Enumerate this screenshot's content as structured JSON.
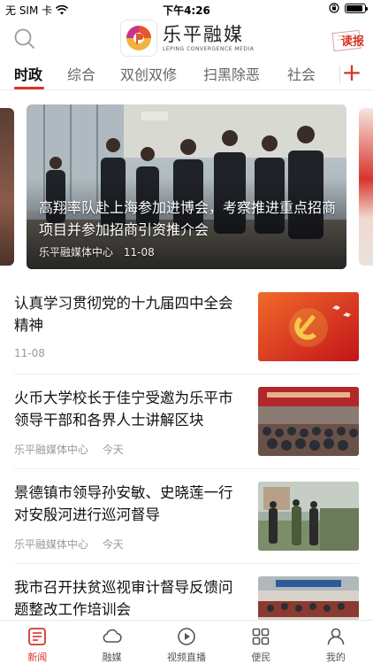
{
  "status_bar": {
    "carrier": "无 SIM 卡",
    "time": "下午4:26",
    "battery_level": 0.9
  },
  "header": {
    "logo_title": "乐平融媒",
    "logo_subtitle": "LEPING CONVERGENCE MEDIA",
    "read_label": "读报"
  },
  "tabs": {
    "items": [
      {
        "label": "时政",
        "active": true
      },
      {
        "label": "综合",
        "active": false
      },
      {
        "label": "双创双修",
        "active": false
      },
      {
        "label": "扫黑除恶",
        "active": false
      },
      {
        "label": "社会",
        "active": false
      }
    ],
    "add_label": "+"
  },
  "carousel": {
    "title": "高翔率队赴上海参加进博会，考察推进重点招商项目并参加招商引资推介会",
    "source": "乐平融媒体中心",
    "date": "11-08"
  },
  "news": [
    {
      "title": "认真学习贯彻党的十九届四中全会精神",
      "source": "",
      "date": "11-08"
    },
    {
      "title": "火币大学校长于佳宁受邀为乐平市领导干部和各界人士讲解区块",
      "source": "乐平融媒体中心",
      "date": "今天"
    },
    {
      "title": "景德镇市领导孙安敏、史晓莲一行对安殷河进行巡河督导",
      "source": "乐平融媒体中心",
      "date": "今天"
    },
    {
      "title": "我市召开扶贫巡视审计督导反馈问题整改工作培训会",
      "source": "",
      "date": ""
    }
  ],
  "bottom_nav": {
    "items": [
      {
        "label": "新闻",
        "icon": "news-icon",
        "active": true
      },
      {
        "label": "融媒",
        "icon": "cloud-icon",
        "active": false
      },
      {
        "label": "视频直播",
        "icon": "play-icon",
        "active": false
      },
      {
        "label": "便民",
        "icon": "grid-icon",
        "active": false
      },
      {
        "label": "我的",
        "icon": "person-icon",
        "active": false
      }
    ]
  },
  "colors": {
    "accent": "#d8342c",
    "text_primary": "#111111",
    "text_meta": "#999999"
  }
}
